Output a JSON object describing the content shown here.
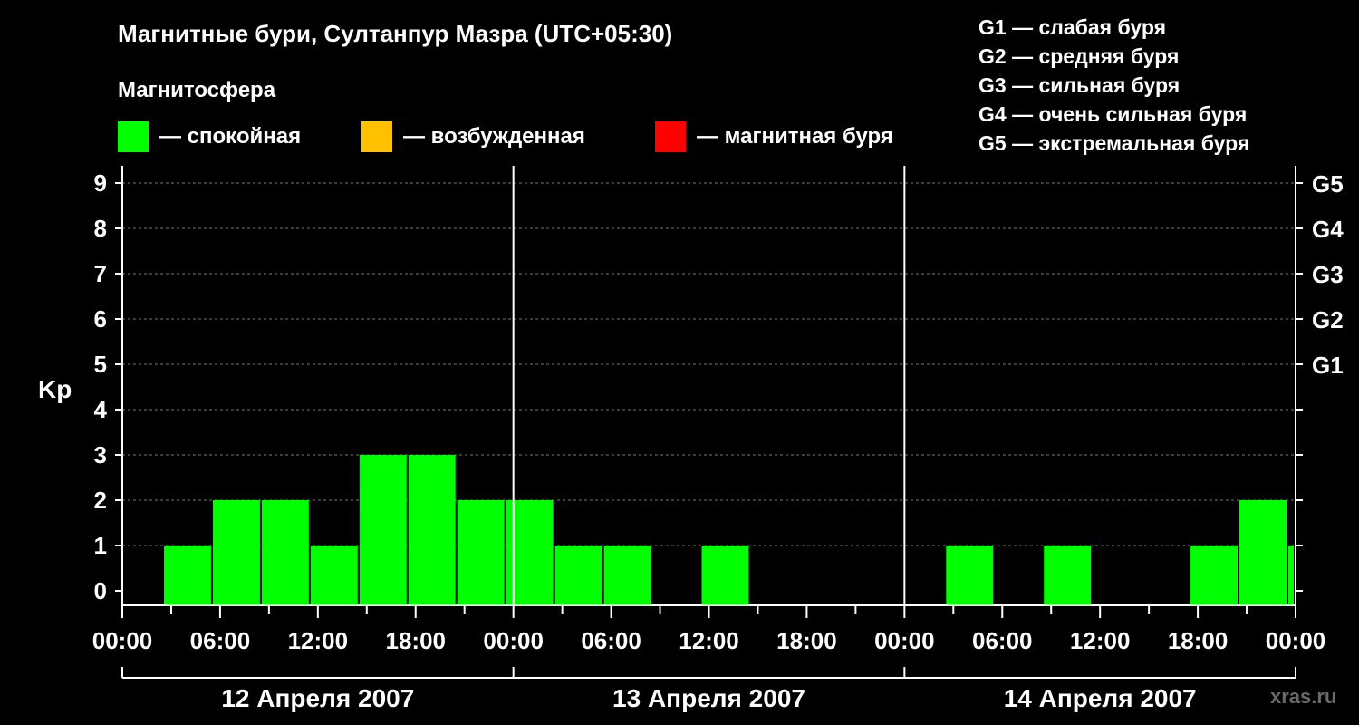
{
  "title": "Магнитные бури, Султанпур Мазра (UTC+05:30)",
  "subtitle": "Магнитосфера",
  "legend": [
    {
      "label": "— спокойная",
      "color": "#00ff00"
    },
    {
      "label": "— возбужденная",
      "color": "#ffc000"
    },
    {
      "label": "— магнитная буря",
      "color": "#ff0000"
    }
  ],
  "g_scale_legend": [
    "G1 — слабая буря",
    "G2 — средняя буря",
    "G3 — сильная буря",
    "G4 — очень сильная буря",
    "G5 — экстремальная буря"
  ],
  "watermark": "xras.ru",
  "chart_data": {
    "type": "bar",
    "ylabel": "Kp",
    "ylim": [
      0,
      9
    ],
    "y_ticks": [
      "0",
      "1",
      "2",
      "3",
      "4",
      "5",
      "6",
      "7",
      "8",
      "9"
    ],
    "g_levels": [
      {
        "label": "G1",
        "kp": 5
      },
      {
        "label": "G2",
        "kp": 6
      },
      {
        "label": "G3",
        "kp": 7
      },
      {
        "label": "G4",
        "kp": 8
      },
      {
        "label": "G5",
        "kp": 9
      }
    ],
    "x_tick_labels": [
      "00:00",
      "06:00",
      "12:00",
      "18:00",
      "00:00",
      "06:00",
      "12:00",
      "18:00",
      "00:00",
      "06:00",
      "12:00",
      "18:00",
      "00:00"
    ],
    "days": [
      "12 Апреля 2007",
      "13 Апреля 2007",
      "14 Апреля 2007"
    ],
    "x_range_hours": [
      0,
      72
    ],
    "grid": true,
    "series": [
      {
        "color": "#00ff00",
        "bars": [
          {
            "start_h": 2.5,
            "value": 1
          },
          {
            "start_h": 5.5,
            "value": 2
          },
          {
            "start_h": 8.5,
            "value": 2
          },
          {
            "start_h": 11.5,
            "value": 1
          },
          {
            "start_h": 14.5,
            "value": 3
          },
          {
            "start_h": 17.5,
            "value": 3
          },
          {
            "start_h": 20.5,
            "value": 2
          },
          {
            "start_h": 23.5,
            "value": 2
          },
          {
            "start_h": 26.5,
            "value": 1
          },
          {
            "start_h": 29.5,
            "value": 1
          },
          {
            "start_h": 35.5,
            "value": 1
          },
          {
            "start_h": 50.5,
            "value": 1
          },
          {
            "start_h": 56.5,
            "value": 1
          },
          {
            "start_h": 65.5,
            "value": 1
          },
          {
            "start_h": 68.5,
            "value": 2
          },
          {
            "start_h": 71.5,
            "value": 1,
            "end_h": 72
          }
        ]
      }
    ]
  }
}
